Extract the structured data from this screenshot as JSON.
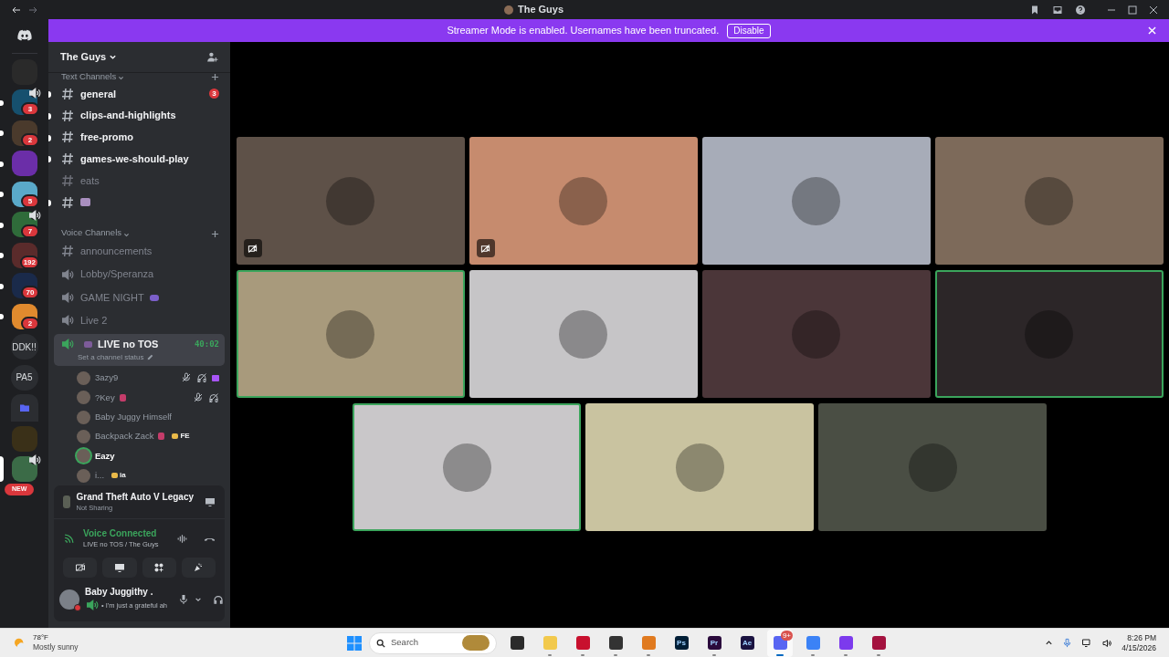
{
  "window": {
    "title": "The Guys"
  },
  "banner": {
    "text": "Streamer Mode is enabled. Usernames have been truncated.",
    "button": "Disable"
  },
  "servers": [
    {
      "kind": "image",
      "unread": false,
      "selected": false,
      "speaker": false
    },
    {
      "kind": "image",
      "badge": "3",
      "unread": true,
      "selected": false,
      "speaker": true
    },
    {
      "kind": "image",
      "badge": "2",
      "unread": true,
      "selected": false,
      "speaker": false
    },
    {
      "kind": "image",
      "unread": true,
      "selected": false,
      "speaker": false
    },
    {
      "kind": "image",
      "badge": "5",
      "unread": true,
      "selected": false,
      "speaker": false
    },
    {
      "kind": "image",
      "badge": "7",
      "unread": true,
      "selected": false,
      "speaker": true
    },
    {
      "kind": "image",
      "badge": "192",
      "unread": true,
      "selected": false,
      "speaker": false
    },
    {
      "kind": "image",
      "badge": "70",
      "unread": true,
      "selected": false,
      "speaker": false
    },
    {
      "kind": "image",
      "badge": "2",
      "unread": true,
      "selected": false,
      "speaker": false
    },
    {
      "kind": "text",
      "label": "DDK!!",
      "unread": false,
      "selected": false,
      "speaker": false
    },
    {
      "kind": "text",
      "label": "PA5",
      "unread": false,
      "selected": false,
      "speaker": false
    },
    {
      "kind": "folder",
      "unread": false,
      "selected": false,
      "speaker": false
    },
    {
      "kind": "image",
      "unread": false,
      "selected": false,
      "speaker": false
    },
    {
      "kind": "image",
      "unread": false,
      "selected": true,
      "speaker": true
    }
  ],
  "new_pill": "NEW",
  "server_name": "The Guys",
  "text_section": "Text Channels",
  "text_channels": [
    {
      "name": "general",
      "unread": true,
      "badge": "3"
    },
    {
      "name": "clips-and-highlights",
      "unread": true
    },
    {
      "name": "free-promo",
      "unread": true
    },
    {
      "name": "games-we-should-play",
      "unread": true
    },
    {
      "name": "eats",
      "unread": false
    },
    {
      "unread": true
    }
  ],
  "voice_section": "Voice Channels",
  "voice_channels": [
    {
      "kind": "text",
      "name": "announcements",
      "selected": false
    },
    {
      "kind": "voice",
      "name": "Lobby/Speranza",
      "selected": false
    },
    {
      "kind": "voice",
      "name": "GAME NIGHT",
      "emoji": true,
      "selected": false
    },
    {
      "kind": "voice",
      "name": "Live 2",
      "selected": false
    },
    {
      "kind": "voice",
      "name": "LIVE no TOS",
      "emoji": true,
      "selected": true,
      "timer": "40:02",
      "status": "Set a channel status",
      "members": [
        {
          "name": "3azy9",
          "speaking": false,
          "muted": true,
          "deafened": true,
          "activity": true
        },
        {
          "name": "?Key",
          "emoji": true,
          "speaking": false,
          "muted": true,
          "deafened": true
        },
        {
          "name": "Baby Juggy Himself",
          "speaking": false
        },
        {
          "name": "Backpack Zack",
          "emoji": true,
          "tag": "FE",
          "speaking": false
        },
        {
          "name": "Eazy",
          "speaking": true
        },
        {
          "name": "i...",
          "tag": "ia",
          "speaking": false
        }
      ]
    }
  ],
  "activity": {
    "game": "Grand Theft Auto V Legacy",
    "state": "Not Sharing"
  },
  "voice": {
    "status": "Voice Connected",
    "channel": "LIVE no TOS / The Guys"
  },
  "user": {
    "name": "Baby Juggithy .",
    "status": "• I'm just a grateful ah"
  },
  "tiles": [
    {
      "color": "#5e5148",
      "speaking": false,
      "video_off": true
    },
    {
      "color": "#c68b6e",
      "speaking": false,
      "video_off": true
    },
    {
      "color": "#a7acb8",
      "speaking": false,
      "video_off": false
    },
    {
      "color": "#7d6a5a",
      "speaking": false,
      "video_off": false
    },
    {
      "color": "#a89a7c",
      "speaking": true,
      "video_off": false
    },
    {
      "color": "#c6c5c7",
      "speaking": false,
      "video_off": false
    },
    {
      "color": "#4b3639",
      "speaking": false,
      "video_off": false
    },
    {
      "color": "#2c2628",
      "speaking": true,
      "video_off": false
    },
    {
      "color": "#c9c7c9",
      "speaking": true,
      "video_off": false
    },
    {
      "color": "#c9c3a0",
      "speaking": false,
      "video_off": false
    },
    {
      "color": "#4a4e44",
      "speaking": false,
      "video_off": false
    }
  ],
  "taskbar": {
    "temperature": "78°F",
    "weather": "Mostly sunny",
    "search": "Search",
    "apps": [
      {
        "color": "#2b2b2b",
        "running": false
      },
      {
        "color": "#f2c94c",
        "running": true
      },
      {
        "color": "#c8102e",
        "running": true
      },
      {
        "color": "#333333",
        "running": true
      },
      {
        "color": "#e07a1f",
        "running": true
      },
      {
        "color": "#001e36",
        "label": "Ps",
        "running": false
      },
      {
        "color": "#2a0a3c",
        "label": "Pr",
        "running": true
      },
      {
        "color": "#1a1240",
        "label": "Ae",
        "running": false
      },
      {
        "color": "#5865f2",
        "running": true,
        "badge": "9+",
        "active": true
      },
      {
        "color": "#3b82f6",
        "running": true
      },
      {
        "color": "#7c3aed",
        "running": true
      },
      {
        "color": "#a4123f",
        "running": true
      }
    ],
    "time": "8:26 PM",
    "date": "4/15/2026"
  }
}
